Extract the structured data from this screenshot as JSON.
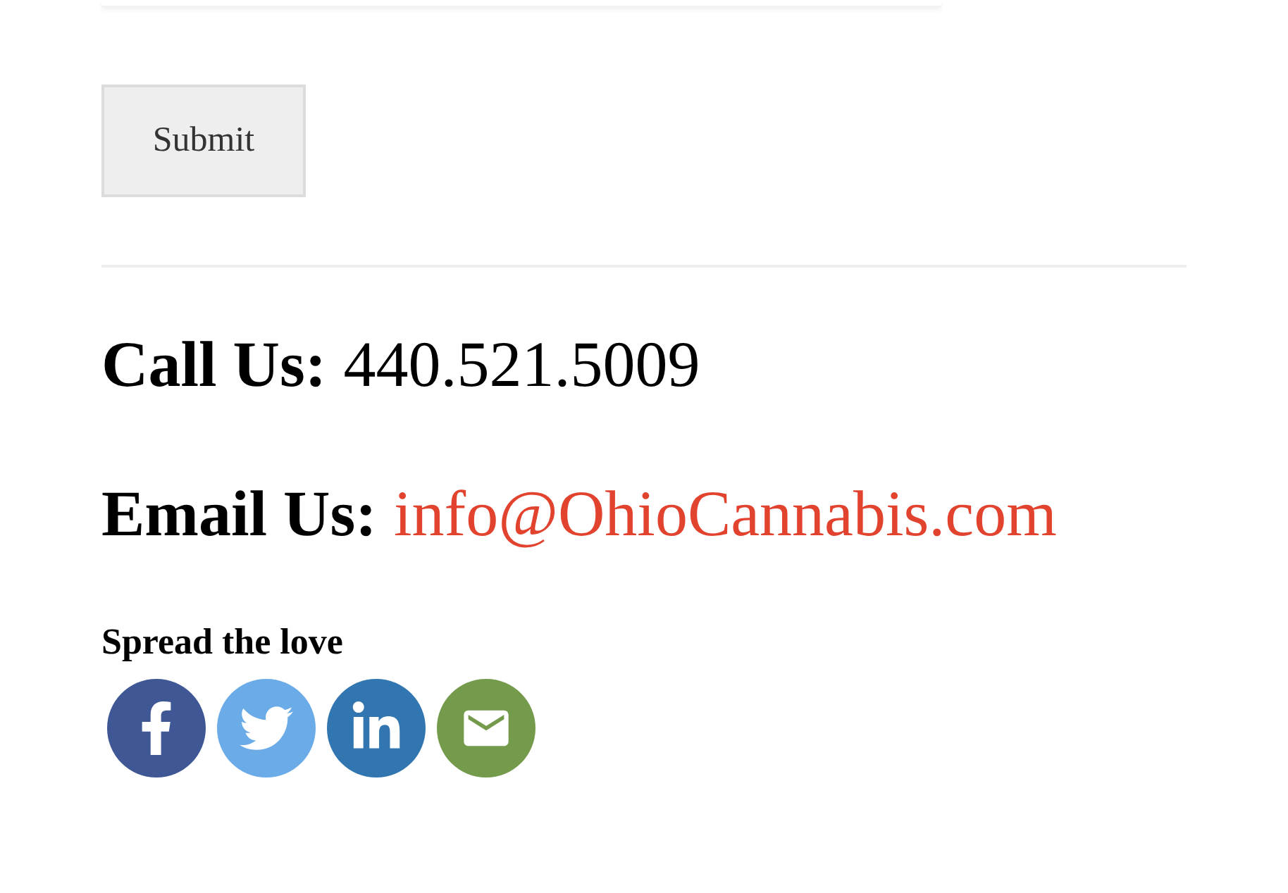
{
  "form": {
    "submit_button": "Submit"
  },
  "contact": [
    {
      "label": "Call Us:",
      "value": "440.521.5009",
      "kind": "phone"
    },
    {
      "label": "Email Us:",
      "value": "info@OhioCannabis.com",
      "kind": "email"
    }
  ],
  "share": {
    "heading": "Spread the love",
    "buttons": [
      {
        "kind": "facebook",
        "color": "#3f5794"
      },
      {
        "kind": "twitter",
        "color": "#6aabe8"
      },
      {
        "kind": "linkedin",
        "color": "#3176b0"
      },
      {
        "kind": "email",
        "color": "#749a4c"
      }
    ]
  }
}
